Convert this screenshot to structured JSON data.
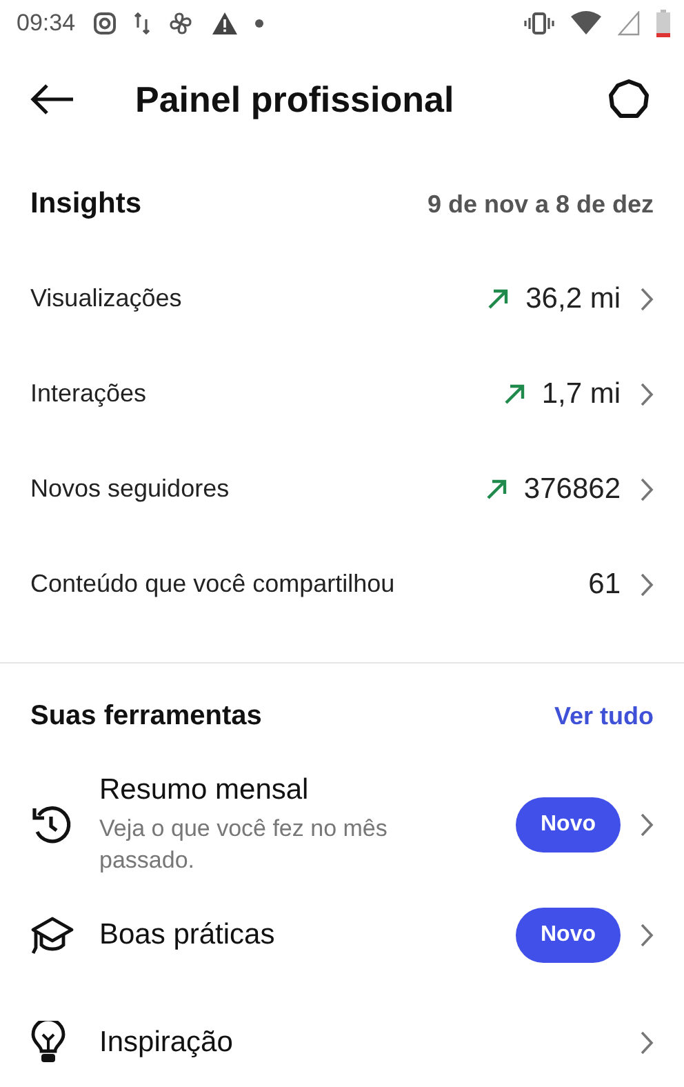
{
  "status_bar": {
    "time": "09:34"
  },
  "header": {
    "title": "Painel profissional"
  },
  "insights": {
    "title": "Insights",
    "date_range": "9 de nov a 8 de dez",
    "rows": [
      {
        "label": "Visualizações",
        "value": "36,2 mi",
        "trending_up": true
      },
      {
        "label": "Interações",
        "value": "1,7 mi",
        "trending_up": true
      },
      {
        "label": "Novos seguidores",
        "value": "376862",
        "trending_up": true
      },
      {
        "label": "Conteúdo que você compartilhou",
        "value": "61",
        "trending_up": false
      }
    ]
  },
  "tools": {
    "title": "Suas ferramentas",
    "link": "Ver tudo",
    "items": [
      {
        "title": "Resumo mensal",
        "subtitle": "Veja o que você fez no mês passado.",
        "badge": "Novo"
      },
      {
        "title": "Boas práticas",
        "badge": "Novo"
      },
      {
        "title": "Inspiração"
      }
    ]
  }
}
